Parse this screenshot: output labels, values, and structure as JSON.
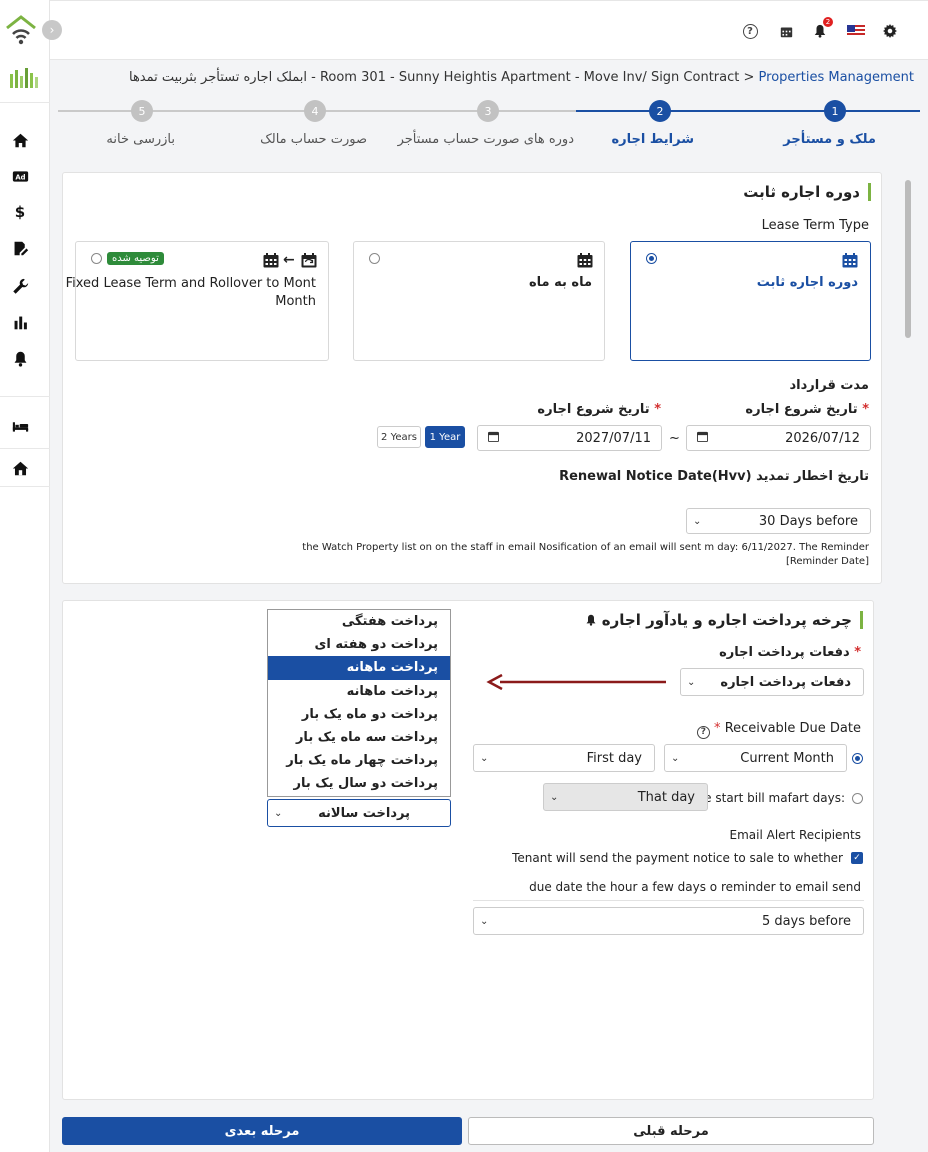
{
  "topbar": {
    "notification_count": "2",
    "icons": [
      "help-icon",
      "calendar-icon",
      "bell-icon",
      "us-flag-icon",
      "gear-icon"
    ]
  },
  "sidebar": {
    "toggle": "›",
    "items": [
      "home-icon",
      "ad-icon",
      "dollar-icon",
      "edit-document-icon",
      "wrench-icon",
      "bar-chart-icon",
      "bell-icon",
      "bed-icon",
      "house-icon"
    ]
  },
  "breadcrumb": {
    "root": "Properties Management",
    "separator": " > ",
    "rest": "ابملک اجاره تستأجر بثربیت تمدها - Room 301 - Sunny Heightis Apartment - Move Inv/ Sign Contract"
  },
  "stepper": {
    "steps": [
      {
        "number": "1",
        "label": "ملک و مستأجر"
      },
      {
        "number": "2",
        "label": "شرایط اجاره"
      },
      {
        "number": "3",
        "label": "دوره های صورت حساب مستأجر"
      },
      {
        "number": "4",
        "label": "صورت حساب مالک"
      },
      {
        "number": "5",
        "label": "بازرسی خانه"
      }
    ],
    "current": 2
  },
  "lease_card": {
    "title": "دوره اجاره ثابت",
    "lease_term_type_label": "Lease Term Type",
    "options": [
      {
        "label": "دوره اجاره ثابت",
        "selected": true
      },
      {
        "label": "ماه به ماه",
        "selected": false
      },
      {
        "label_line1": "Fixed Lease Term and Rollover to Mont",
        "label_line2": "Month",
        "tag": "توصیه شده",
        "selected": false
      }
    ],
    "contract_period_label": "مدت قرارداد",
    "start_date_label": "تاریخ شروع اجاره",
    "end_date_label": "تاریخ شروع اجاره",
    "start_date": "2026/07/12",
    "end_date": "2027/07/11",
    "range_sep": "~",
    "year_buttons": [
      {
        "label": "1 Year",
        "active": true
      },
      {
        "label": "2 Years",
        "active": false
      }
    ],
    "renewal_label": "Renewal Notice Date(Hvv) تاریخ اخطار تمدید",
    "renewal_value": "30 Days before",
    "renewal_note_line1": "the Watch Property list on on the staff in email Nosification of an email will sent m day: 6/11/2027. The Reminder",
    "renewal_note_line2": "[Reminder Date]"
  },
  "payment_card": {
    "title": "چرخه پرداخت اجاره و یادآور اجاره",
    "frequency_label": "دفعات پرداخت اجاره",
    "frequency_value": "دفعات پرداخت اجاره",
    "frequency_options": [
      "پرداخت هفتگی",
      "پرداخت دو هفته ای",
      "پرداخت ماهانه",
      "پرداخت ماهانه",
      "پرداخت دو ماه یک بار",
      "پرداخت سه ماه یک بار",
      "پرداخت چهار ماه یک بار",
      "پرداخت دو سال یک بار"
    ],
    "frequency_highlighted_index": 2,
    "second_select_value": "پرداخت سالانه",
    "due_date_label": "Receivable Due Date",
    "month_value": "Current Month",
    "day_value": "First day",
    "alt_option_label": "date start bill mafart days:",
    "alt_option_value": "That day",
    "email_recipients_label": "Email Alert Recipients",
    "tenant_checkbox_label": "Tenant will send the payment notice to sale to whether",
    "reminder_note": "due date the hour a few days o reminder to email send",
    "reminder_value": "5 days before"
  },
  "footer": {
    "next_label": "مرحله بعدی",
    "prev_label": "مرحله قبلی"
  },
  "colors": {
    "primary": "#1a4fa3",
    "tag_green": "#2e8b3a",
    "arrow_red": "#8b1a1a"
  }
}
